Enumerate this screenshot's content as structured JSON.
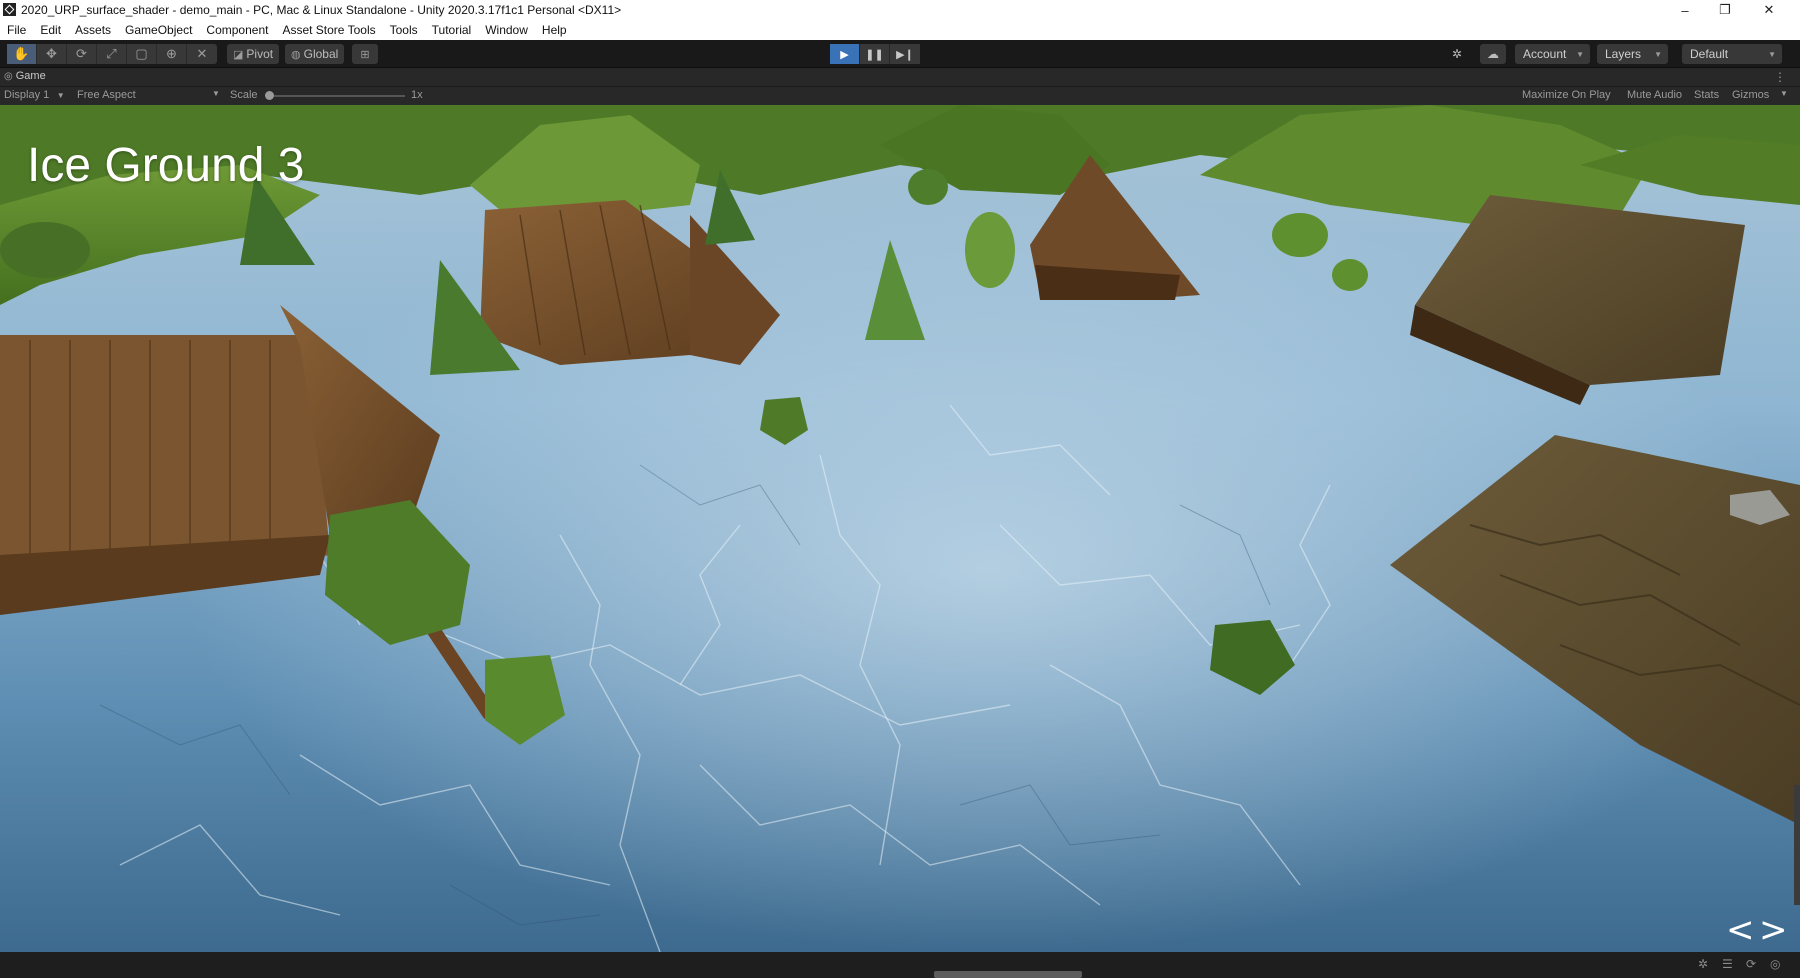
{
  "window": {
    "title": "2020_URP_surface_shader - demo_main - PC, Mac & Linux Standalone - Unity 2020.3.17f1c1 Personal <DX11>",
    "minimize_glyph": "–",
    "restore_glyph": "❐",
    "close_glyph": "✕"
  },
  "menu": [
    "File",
    "Edit",
    "Assets",
    "GameObject",
    "Component",
    "Asset Store Tools",
    "Tools",
    "Tutorial",
    "Window",
    "Help"
  ],
  "toolbar": {
    "pivot_label": "Pivot",
    "global_label": "Global",
    "account_label": "Account",
    "layers_label": "Layers",
    "layout_label": "Default"
  },
  "game_tab": {
    "label": "Game"
  },
  "game_toolbar": {
    "display": "Display 1",
    "aspect": "Free Aspect",
    "scale_label": "Scale",
    "scale_value": "1x",
    "maximize_on_play": "Maximize On Play",
    "mute_audio": "Mute Audio",
    "stats": "Stats",
    "gizmos": "Gizmos"
  },
  "viewport": {
    "scene_title": "Ice Ground 3",
    "prev_glyph": "<",
    "next_glyph": ">"
  },
  "colors": {
    "ice_light": "#a9c9e0",
    "ice_mid": "#5f8fb4",
    "ice_dark": "#2f5878",
    "grass": "#5c8a2c",
    "wood": "#7a5530",
    "play_active": "#3a72b8"
  }
}
